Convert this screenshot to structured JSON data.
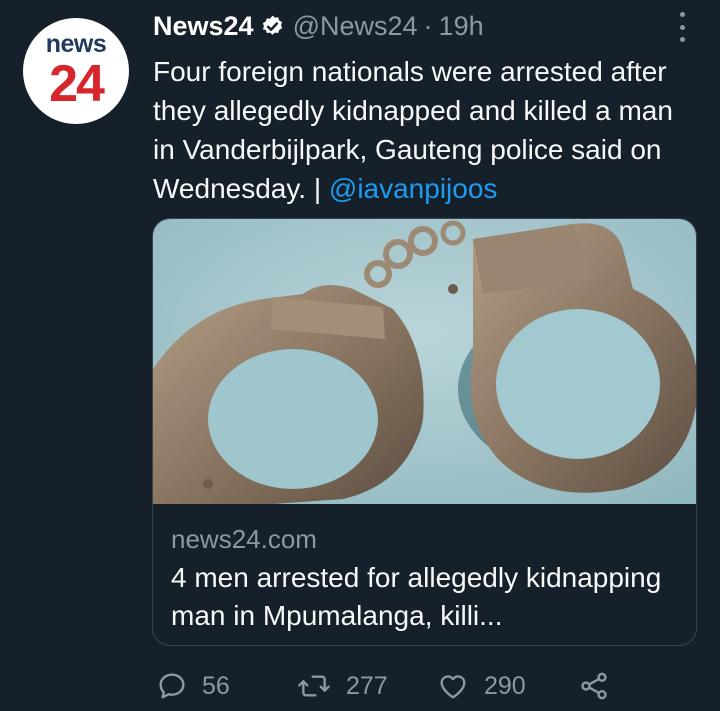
{
  "tweet": {
    "author_name": "News24",
    "handle": "@News24",
    "separator": "·",
    "time": "19h",
    "text_main": "Four foreign nationals were arrested after they allegedly kidnapped and killed a man in Vanderbijlpark, Gauteng police said on Wednesday. | ",
    "mention": "@iavanpijoos",
    "avatar": {
      "line1": "news",
      "line2": "24"
    }
  },
  "card": {
    "image": "handcuffs-photo",
    "domain": "news24.com",
    "title": "4 men arrested for allegedly kidnapping man in Mpumalanga, killi..."
  },
  "actions": {
    "reply_count": "56",
    "retweet_count": "277",
    "like_count": "290"
  },
  "colors": {
    "background": "#15202b",
    "secondary_text": "#8b98a5",
    "link": "#1d9bf0",
    "border": "#38444d"
  }
}
